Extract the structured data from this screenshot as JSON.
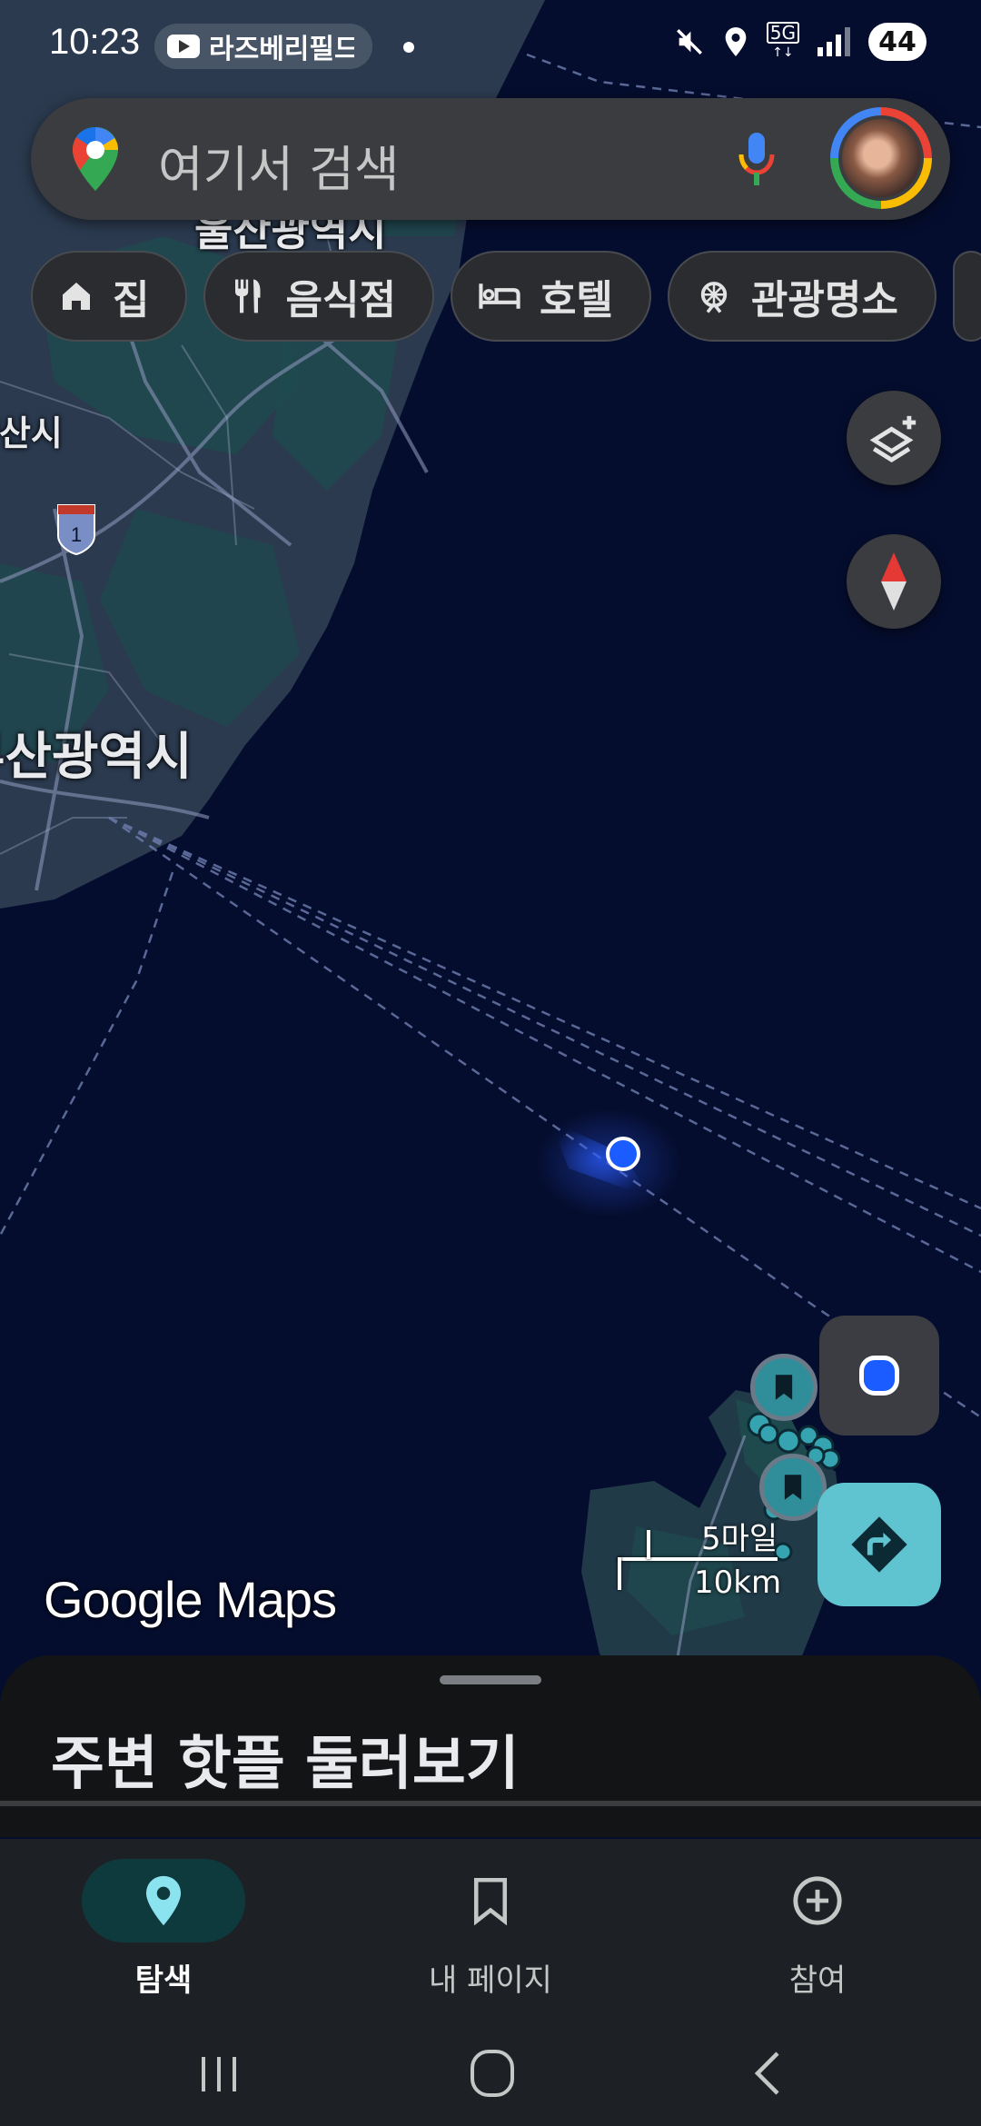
{
  "status_bar": {
    "time": "10:23",
    "media_app": "라즈베리필드",
    "network": "5G",
    "battery": "44"
  },
  "search": {
    "placeholder": "여기서 검색"
  },
  "chips": [
    {
      "label": "집",
      "icon": "home-icon"
    },
    {
      "label": "음식점",
      "icon": "restaurant-icon"
    },
    {
      "label": "호텔",
      "icon": "hotel-icon"
    },
    {
      "label": "관광명소",
      "icon": "attraction-icon"
    }
  ],
  "map": {
    "labels": {
      "ulsan": "울산광역시",
      "yangsan": "양산시",
      "busan": "부산광역시",
      "route_shield": "1"
    },
    "scale": {
      "miles": "5마일",
      "km": "10km"
    },
    "attribution": "Google Maps",
    "colors": {
      "water": "#050d2e",
      "land": "#2b3a4f",
      "park": "#1e4a4e",
      "location_dot": "#1a5cff",
      "directions_button": "#5fc3d0"
    }
  },
  "sheet": {
    "title": "주변 핫플 둘러보기"
  },
  "bottom_nav": [
    {
      "label": "탐색",
      "icon": "explore-pin-icon",
      "active": true
    },
    {
      "label": "내 페이지",
      "icon": "bookmark-icon",
      "active": false
    },
    {
      "label": "참여",
      "icon": "add-circle-icon",
      "active": false
    }
  ]
}
